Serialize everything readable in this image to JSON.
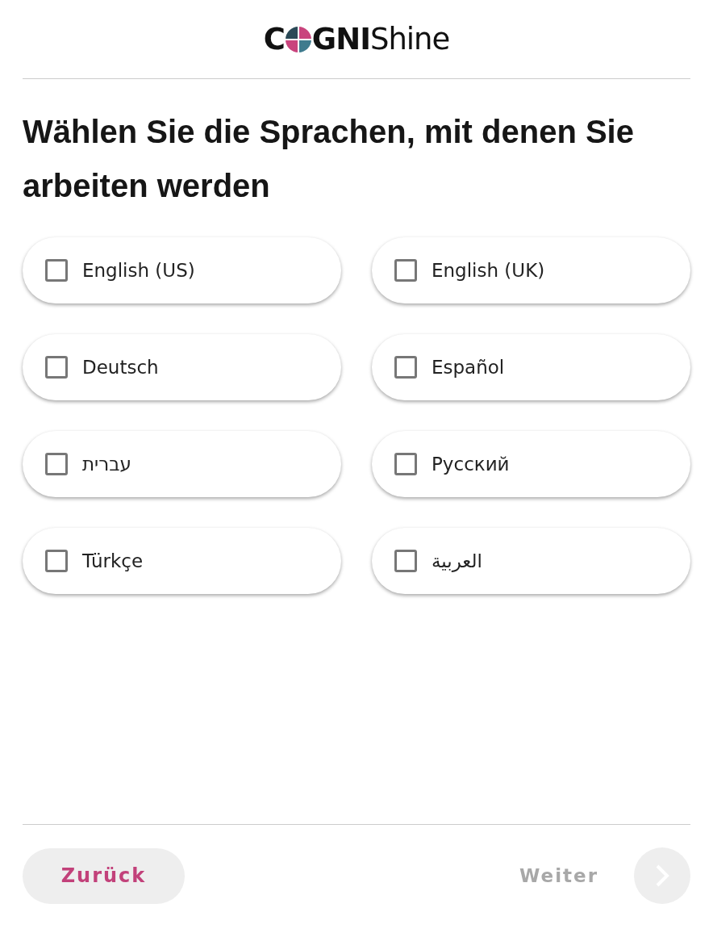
{
  "logo": {
    "parts": [
      "C",
      "GNI",
      "Shine"
    ]
  },
  "title": "Wählen Sie die Sprachen, mit denen Sie arbeiten werden",
  "languages": [
    {
      "label": "English (US)",
      "checked": false
    },
    {
      "label": "English (UK)",
      "checked": false
    },
    {
      "label": "Deutsch",
      "checked": false
    },
    {
      "label": "Español",
      "checked": false
    },
    {
      "label": "עברית",
      "checked": false
    },
    {
      "label": "Русский",
      "checked": false
    },
    {
      "label": "Türkçe",
      "checked": false
    },
    {
      "label": "العربية",
      "checked": false
    }
  ],
  "back_button": {
    "label": "Zurück"
  },
  "next_button": {
    "label": "Weiter",
    "disabled": true
  }
}
